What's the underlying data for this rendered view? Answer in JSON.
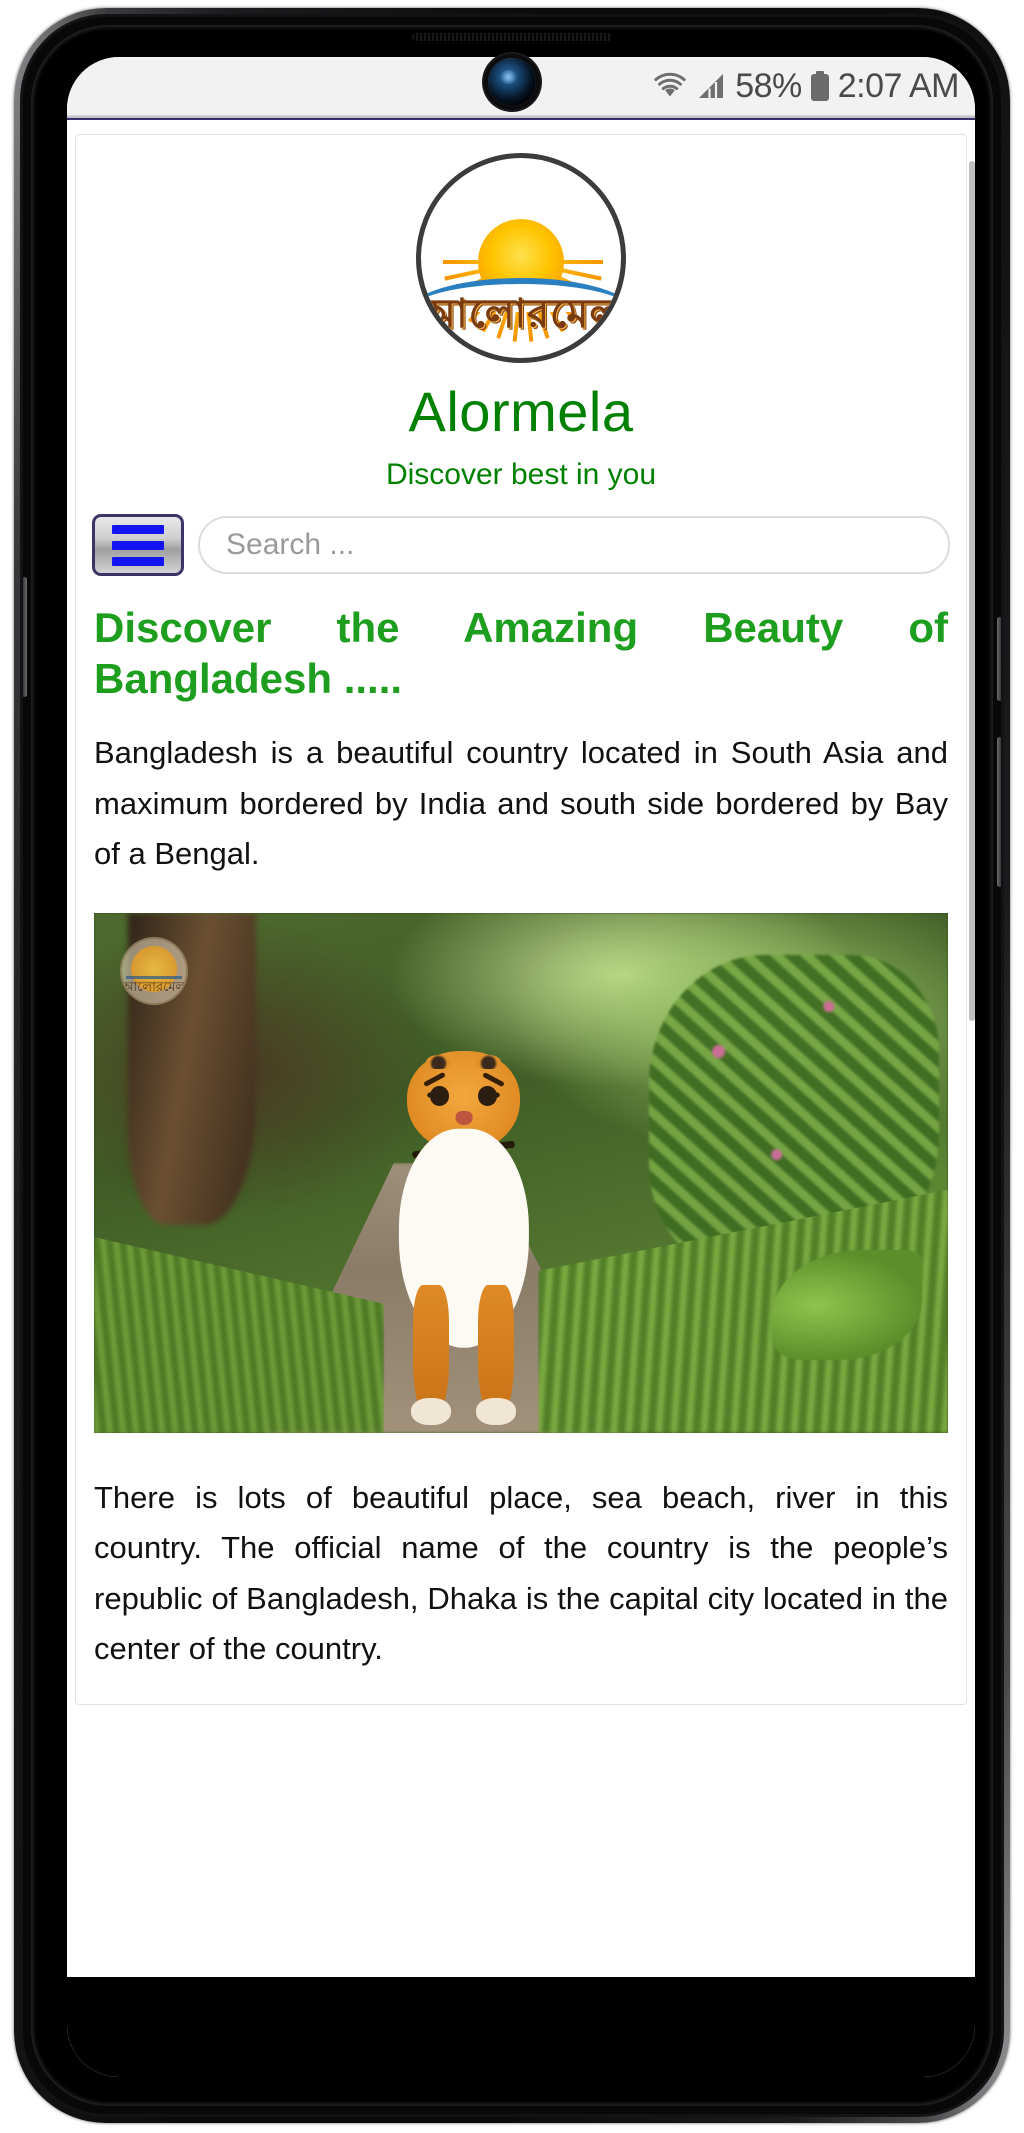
{
  "status_bar": {
    "wifi_icon": "wifi-icon",
    "signal_icon": "cellular-signal-icon",
    "battery_percent": "58%",
    "battery_icon": "battery-icon",
    "time": "2:07 AM"
  },
  "device": {
    "front_camera_icon": "front-camera-icon",
    "earpiece_icon": "earpiece-speaker-icon"
  },
  "site": {
    "logo_bengali": "আলোরমেলা",
    "logo_icon": "sunrise-logo-icon",
    "title": "Alormela",
    "tagline": "Discover best in you",
    "brand_color": "#008000"
  },
  "nav": {
    "menu_button_icon": "hamburger-menu-icon",
    "menu_button_label": "",
    "search_placeholder": "Search ...",
    "search_value": "",
    "search_icon": "search-icon"
  },
  "article": {
    "heading": "Discover the Amazing Beauty of Bangladesh .....",
    "heading_color": "#1e9e1e",
    "paragraph_1": "Bangladesh is a beautiful country located in South Asia and maximum bordered by India and south side bordered by Bay of a Bengal.",
    "image": {
      "name": "tiger-photo",
      "alt": "Royal Bengal tiger walking on a forest path",
      "watermark_bengali": "আলোরমেলা",
      "watermark_icon": "alormela-watermark-icon"
    },
    "paragraph_2": "There is lots of beautiful place, sea beach, river in this country. The official name of the country is the people’s republic of Bangladesh, Dhaka is the capital city located in the center of the country."
  }
}
